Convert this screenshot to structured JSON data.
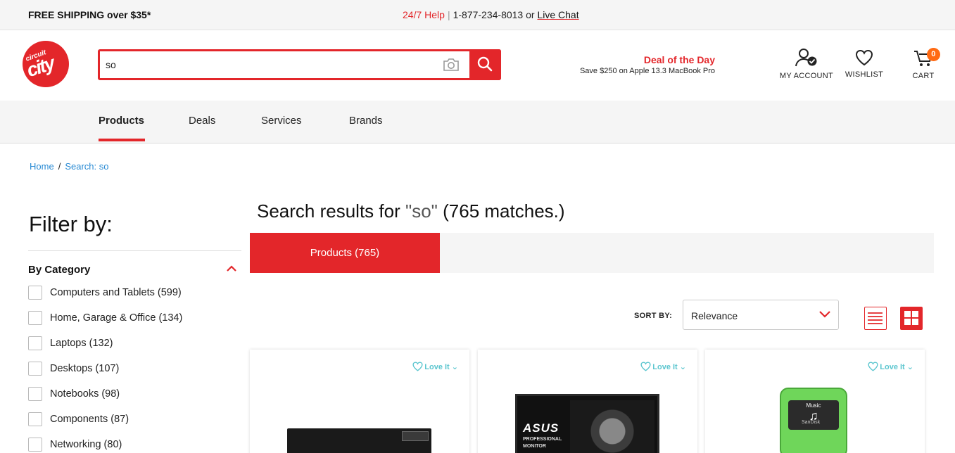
{
  "topbar": {
    "shipping": "FREE SHIPPING over $35*",
    "help_label": "24/7 Help",
    "separator": "|",
    "phone": "1-877-234-8013 or",
    "chat": "Live Chat"
  },
  "logo": {
    "line1": "circuit",
    "line2": "city"
  },
  "search": {
    "value": "so",
    "placeholder": ""
  },
  "deal": {
    "title": "Deal of the Day",
    "subtitle": "Save $250 on Apple 13.3 MacBook Pro"
  },
  "header": {
    "account": "MY ACCOUNT",
    "wishlist": "WISHLIST",
    "cart": "CART",
    "cart_count": "0"
  },
  "nav": {
    "items": [
      "Products",
      "Deals",
      "Services",
      "Brands"
    ],
    "active": "Products"
  },
  "breadcrumb": {
    "home": "Home",
    "separator": "/",
    "current": "Search: so"
  },
  "filter": {
    "title": "Filter by:",
    "category_heading": "By Category",
    "categories": [
      "Computers and Tablets (599)",
      "Home, Garage & Office (134)",
      "Laptops (132)",
      "Desktops (107)",
      "Notebooks (98)",
      "Components (87)",
      "Networking (80)"
    ]
  },
  "results": {
    "prefix": "Search results for ",
    "query": "\"so\"",
    "suffix": " (765 matches.)",
    "tab": "Products (765)"
  },
  "sort": {
    "label": "SORT BY:",
    "value": "Relevance"
  },
  "cards": [
    {
      "love": "Love It"
    },
    {
      "love": "Love It",
      "brand": "ASUS",
      "sub": "PROFESSIONAL MONITOR"
    },
    {
      "love": "Love It",
      "screen": "Music",
      "maker": "SanDisk"
    }
  ],
  "colors": {
    "brand_red": "#e3262a",
    "link_blue": "#2a8bd4",
    "love_teal": "#5cc6cf",
    "badge_orange": "#ff6a13"
  }
}
